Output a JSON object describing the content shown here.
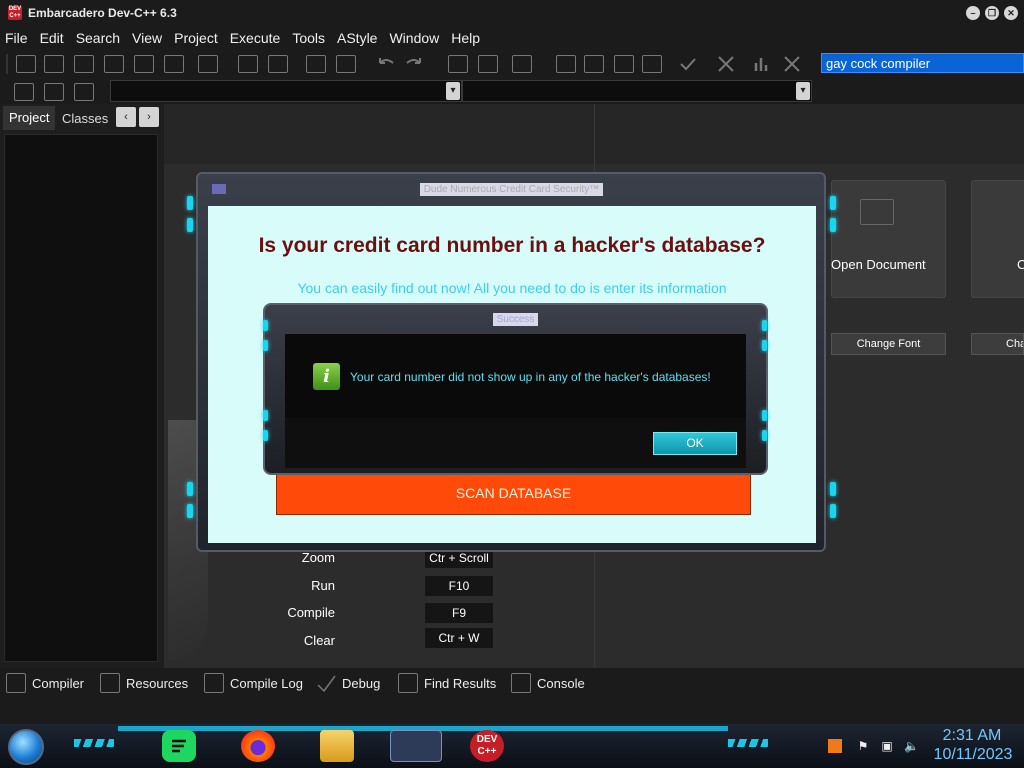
{
  "window": {
    "title": "Embarcadero Dev-C++ 6.3",
    "app_icon_text": "DEV C++"
  },
  "menu": [
    "File",
    "Edit",
    "Search",
    "View",
    "Project",
    "Execute",
    "Tools",
    "AStyle",
    "Window",
    "Help"
  ],
  "toolbar": {
    "compiler": "gay cock compiler"
  },
  "left_panel": {
    "tabs": [
      "Project",
      "Classes"
    ],
    "prev": "‹",
    "next": "›"
  },
  "welcome": {
    "tiles": [
      {
        "label": "Open Document"
      },
      {
        "label": "C"
      }
    ],
    "buttons": [
      "Change Font",
      "Cha"
    ],
    "shortcuts": [
      {
        "label": "Zoom",
        "key": "Ctr + Scroll"
      },
      {
        "label": "Run",
        "key": "F10"
      },
      {
        "label": "Compile",
        "key": "F9"
      },
      {
        "label": "Clear",
        "key": "Ctr + W"
      }
    ]
  },
  "bottom_tabs": [
    "Compiler",
    "Resources",
    "Compile Log",
    "Debug",
    "Find Results",
    "Console"
  ],
  "main_dialog": {
    "title": "Dude Numerous Credit Card Security™",
    "headline": "Is your credit card number in a hacker's database?",
    "subtext": "You can easily find out now! All you need to do is enter its information",
    "scan_button": "SCAN DATABASE"
  },
  "message_box": {
    "title": "Success",
    "message": "Your card number did not show up in any of the hacker's databases!",
    "ok_button": "OK",
    "icon": "info-icon"
  },
  "taskbar": {
    "apps": [
      "spotify-icon",
      "firefox-icon",
      "file-explorer-icon",
      "dialog-app-icon",
      "devcpp-icon"
    ],
    "devcpp_text": "DEV C++",
    "clock_time": "2:31 AM",
    "clock_date": "10/11/2023"
  },
  "colors": {
    "accent_cyan": "#19d6f0",
    "scan_orange": "#ff4a0a",
    "headline_red": "#6b0f0f",
    "compiler_blue": "#0a64d6"
  }
}
